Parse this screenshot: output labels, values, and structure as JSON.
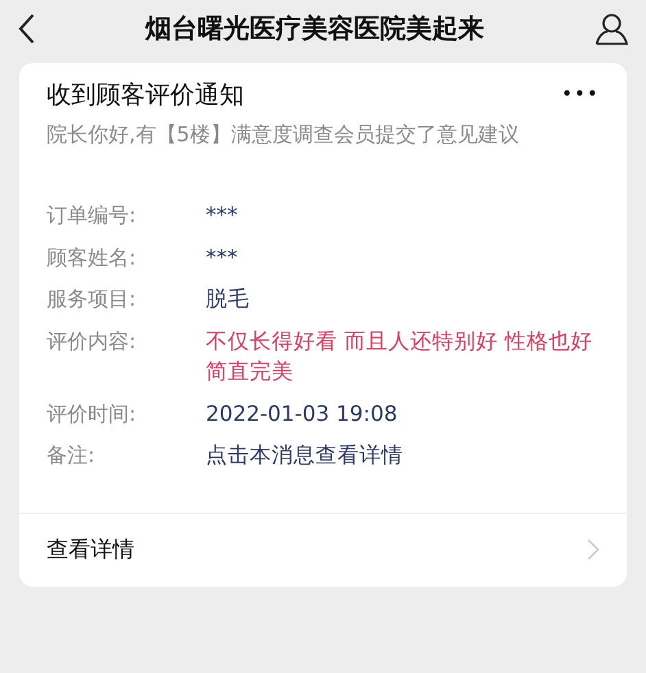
{
  "header": {
    "title": "烟台曙光医疗美容医院美起来"
  },
  "card": {
    "title": "收到顾客评价通知",
    "more": "•••",
    "description": "院长你好,有【5楼】满意度调查会员提交了意见建议",
    "fields": [
      {
        "label": "订单编号:",
        "kind": "normal",
        "lines": [
          "***"
        ]
      },
      {
        "label": "顾客姓名:",
        "kind": "normal",
        "lines": [
          "***"
        ]
      },
      {
        "label": "服务项目:",
        "kind": "normal",
        "lines": [
          "脱毛"
        ]
      },
      {
        "label": "评价内容:",
        "kind": "highlight",
        "lines": [
          "不仅长得好看 而且人还特别好 性格也好",
          "简直完美"
        ]
      },
      {
        "label": "评价时间:",
        "kind": "normal",
        "lines": [
          "2022-01-03 19:08"
        ]
      },
      {
        "label": "备注:",
        "kind": "normal",
        "lines": [
          "点击本消息查看详情"
        ]
      }
    ],
    "footer_link": "查看详情"
  }
}
